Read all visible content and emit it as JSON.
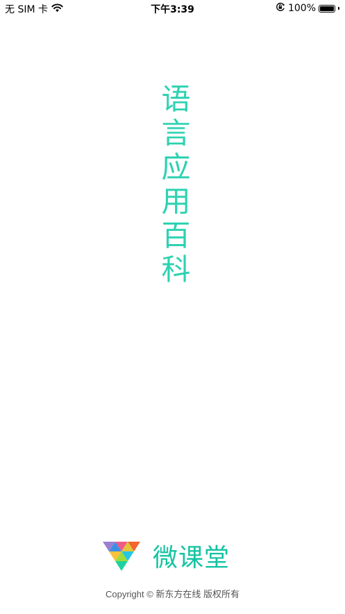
{
  "status_bar": {
    "carrier": "无 SIM 卡",
    "time": "下午3:39",
    "battery_percent": "100%",
    "battery_level": 1.0,
    "icons": [
      "wifi-icon",
      "orientation-lock-icon",
      "battery-icon"
    ]
  },
  "splash": {
    "title": "语言应用百科",
    "title_color": "#2dd2b1"
  },
  "footer": {
    "logo_text": "微课堂",
    "logo_color": "#14c3a3",
    "logo_icon": "v-logo-icon",
    "copyright": "Copyright © 新东方在线 版权所有"
  }
}
